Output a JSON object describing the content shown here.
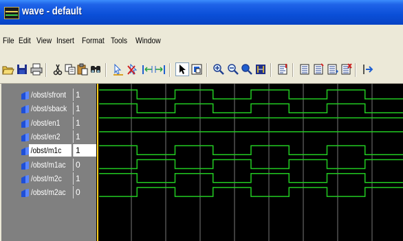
{
  "window": {
    "title": "wave - default"
  },
  "menu": [
    "File",
    "Edit",
    "View",
    "Insert",
    "Format",
    "Tools",
    "Window"
  ],
  "toolbar": {
    "buttons": [
      "open-icon",
      "save-icon",
      "print-icon",
      "cut-icon",
      "copy-icon",
      "paste-icon",
      "find-icon",
      "insert-cursor-icon",
      "delete-cursor-icon",
      "cursor-prev-icon",
      "cursor-next-icon",
      "select-mode-icon",
      "zoom-mode-icon",
      "zoom-in-icon",
      "zoom-out-icon",
      "zoom-full-icon",
      "zoom-cursor-icon",
      "edge-find-icon",
      "wave-edit-icon",
      "wave-add-icon",
      "wave-insert-icon",
      "wave-delete-icon",
      "wave-split-icon"
    ],
    "pressed": "select-mode-icon"
  },
  "signals": [
    {
      "name": "/obst/sfront",
      "value": "1",
      "selected": false,
      "wave": [
        1,
        0,
        1,
        0,
        1,
        0,
        1,
        0
      ]
    },
    {
      "name": "/obst/sback",
      "value": "1",
      "selected": false,
      "wave": [
        1,
        0,
        1,
        0,
        1,
        0,
        1,
        0
      ]
    },
    {
      "name": "/obst/en1",
      "value": "1",
      "selected": false,
      "wave": [
        1
      ]
    },
    {
      "name": "/obst/en2",
      "value": "1",
      "selected": false,
      "wave": [
        1
      ]
    },
    {
      "name": "/obst/m1c",
      "value": "1",
      "selected": true,
      "wave": [
        1,
        0,
        1,
        0,
        1,
        0,
        1,
        0
      ]
    },
    {
      "name": "/obst/m1ac",
      "value": "0",
      "selected": false,
      "wave": [
        0,
        1,
        0,
        1,
        0,
        1,
        0,
        1
      ]
    },
    {
      "name": "/obst/m2c",
      "value": "1",
      "selected": false,
      "wave": [
        1,
        0,
        1,
        0,
        1,
        0,
        1,
        0
      ]
    },
    {
      "name": "/obst/m2ac",
      "value": "0",
      "selected": false,
      "wave": [
        0,
        1,
        0,
        1,
        0,
        1,
        0,
        1
      ]
    }
  ],
  "colors": {
    "wave": "#22cc22",
    "grid": "#7a7a7a",
    "cursor": "#ffd21e",
    "signal_icon": "#1f4fd6"
  }
}
